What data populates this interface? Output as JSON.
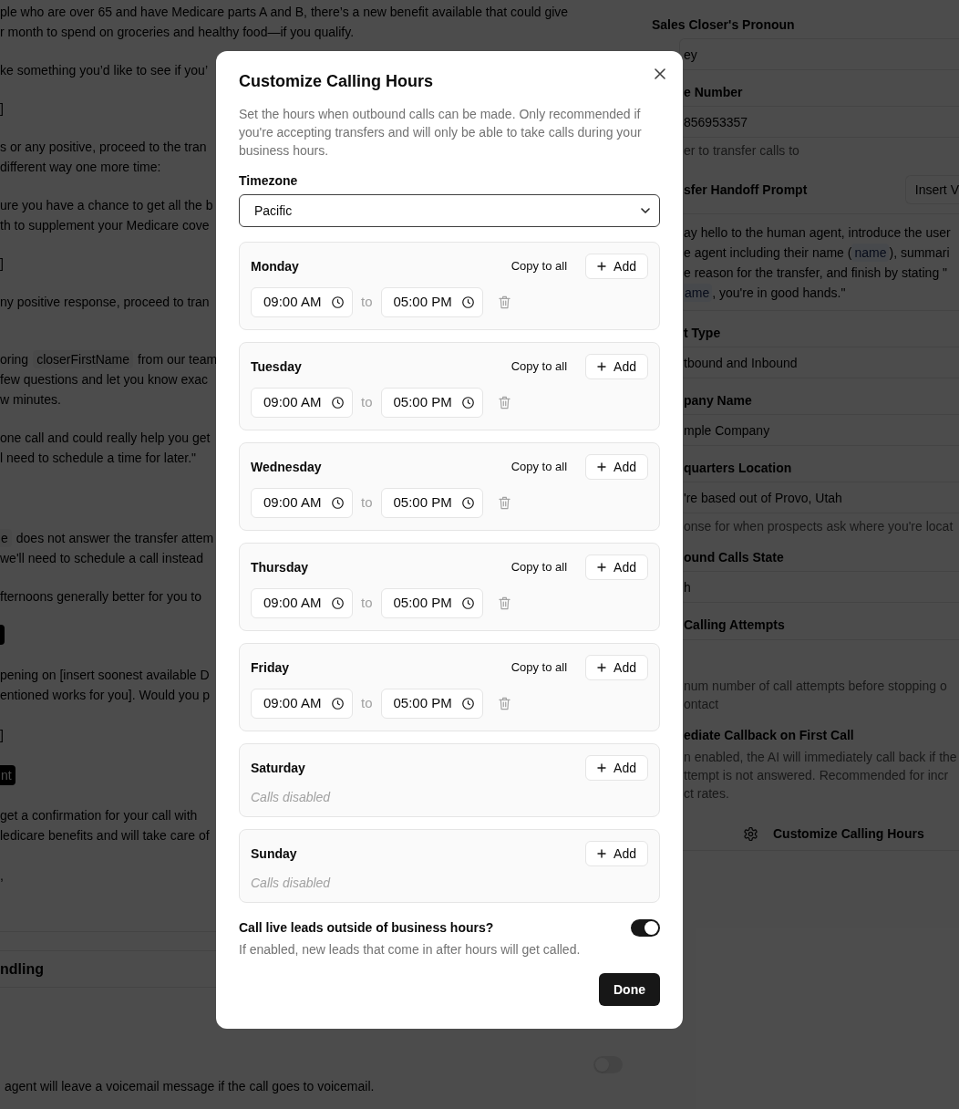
{
  "editor": {
    "paragraphs": [
      {
        "lines": [
          [
            {
              "kind": "text",
              "text": "ple who are over 65 and have Medicare parts A and B, there’s a new benefit available that could give"
            }
          ],
          [
            {
              "kind": "text",
              "text": "r month to spend on groceries and healthy food—if you qualify."
            }
          ]
        ]
      },
      {
        "lines": [
          [
            {
              "kind": "text",
              "text": "ke something you’d like to see if you’"
            }
          ]
        ]
      },
      {
        "lines": [
          [
            {
              "kind": "text",
              "text": "]"
            }
          ]
        ]
      },
      {
        "lines": [
          [
            {
              "kind": "text",
              "text": "s or any positive, proceed to the tran"
            }
          ],
          [
            {
              "kind": "text",
              "text": "different way one more time:"
            }
          ]
        ]
      },
      {
        "lines": [
          [
            {
              "kind": "text",
              "text": "ure you have a chance to get all the b"
            }
          ],
          [
            {
              "kind": "text",
              "text": "th to supplement your Medicare cove"
            }
          ]
        ]
      },
      {
        "lines": [
          [
            {
              "kind": "text",
              "text": "]"
            }
          ]
        ]
      },
      {
        "lines": [
          [
            {
              "kind": "text",
              "text": "ny positive response, proceed to tran"
            }
          ]
        ]
      },
      {
        "lines": [
          [
            {
              "kind": "text",
              "text": "oring"
            },
            {
              "kind": "chip",
              "text": "closerFirstName"
            },
            {
              "kind": "text",
              "text": "from our team"
            }
          ],
          [
            {
              "kind": "text",
              "text": "few questions and let you know exac"
            }
          ],
          [
            {
              "kind": "text",
              "text": "w minutes."
            }
          ]
        ]
      },
      {
        "lines": [
          [
            {
              "kind": "text",
              "text": "one call and could really help you get"
            }
          ],
          [
            {
              "kind": "text",
              "text": "l need to schedule a time for later.\""
            }
          ]
        ]
      },
      {
        "lines": [
          [
            {
              "kind": "chip",
              "text": "e"
            },
            {
              "kind": "text",
              "text": "does not answer the transfer attem"
            }
          ],
          [
            {
              "kind": "text",
              "text": "we'll need to schedule a call instead"
            }
          ]
        ]
      },
      {
        "lines": [
          [
            {
              "kind": "text",
              "text": "fternoons generally better for you to"
            }
          ]
        ]
      },
      {
        "lines": [
          [
            {
              "kind": "dark_chip"
            }
          ]
        ]
      },
      {
        "lines": [
          [
            {
              "kind": "text",
              "text": "pening on [insert soonest available D"
            }
          ],
          [
            {
              "kind": "text",
              "text": "entioned works for you]. Would you p"
            }
          ]
        ]
      },
      {
        "lines": [
          [
            {
              "kind": "text",
              "text": "]"
            }
          ]
        ]
      },
      {
        "lines": [
          [
            {
              "kind": "dark_chip",
              "text": "nt"
            }
          ]
        ]
      },
      {
        "lines": [
          [
            {
              "kind": "text",
              "text": "get a confirmation for your call with"
            }
          ],
          [
            {
              "kind": "text",
              "text": "ledicare benefits and will take care of"
            }
          ]
        ]
      },
      {
        "lines": [
          [
            {
              "kind": "text",
              "text": ","
            }
          ]
        ]
      }
    ]
  },
  "section": {
    "title": "ndling",
    "toggle": {
      "on": false
    },
    "description": "agent will leave a voicemail message if the call goes to voicemail."
  },
  "settings": {
    "fields": [
      {
        "kind": "input",
        "label": "Sales Closer's Pronoun",
        "value": "ey"
      },
      {
        "kind": "input",
        "label": "e Number",
        "value": "856953357",
        "help": [
          "er to transfer calls to"
        ]
      },
      {
        "kind": "prompt",
        "label": "sfer Handoff Prompt",
        "button": "Insert V",
        "lines": [
          [
            {
              "kind": "text",
              "text": "ay hello to the human agent, introduce the user"
            }
          ],
          [
            {
              "kind": "text",
              "text": "e agent including their name ("
            },
            {
              "kind": "chip",
              "text": "name"
            },
            {
              "kind": "text",
              "text": "), summari"
            }
          ],
          [
            {
              "kind": "text",
              "text": "e reason for the transfer, and finish by stating \""
            }
          ],
          [
            {
              "kind": "chip",
              "text": "ame"
            },
            {
              "kind": "text",
              "text": ", you're in good hands.\""
            }
          ]
        ]
      },
      {
        "kind": "input",
        "label": "t Type",
        "value": "tbound and Inbound"
      },
      {
        "kind": "input",
        "label": "pany Name",
        "value": "mple Company"
      },
      {
        "kind": "input",
        "label": "quarters Location",
        "value": "'re based out of Provo, Utah",
        "help": [
          "onse for when prospects ask where you're locat"
        ]
      },
      {
        "kind": "input",
        "label": "ound Calls State",
        "value": "h"
      },
      {
        "kind": "number",
        "label": "Calling Attempts",
        "help": [
          "num number of call attempts before stopping o",
          "ontact"
        ]
      },
      {
        "kind": "note",
        "label": "ediate Callback on First Call",
        "help": [
          "n enabled, the AI will immediately call back if the",
          "ttempt is not answered. Recommended for incr",
          "ct rates."
        ]
      }
    ],
    "button": "Customize Calling Hours"
  },
  "dialog": {
    "title": "Customize Calling Hours",
    "description": "Set the hours when outbound calls can be made. Only recommended if you're accepting transfers and will only be able to take calls during your business hours.",
    "timezone": {
      "label": "Timezone",
      "value": "Pacific"
    },
    "days": [
      {
        "name": "Monday",
        "copy_label": "Copy to all",
        "add_label": "Add",
        "slots": [
          {
            "start": "09:00 AM",
            "separator": "to",
            "end": "05:00 PM"
          }
        ]
      },
      {
        "name": "Tuesday",
        "copy_label": "Copy to all",
        "add_label": "Add",
        "slots": [
          {
            "start": "09:00 AM",
            "separator": "to",
            "end": "05:00 PM"
          }
        ]
      },
      {
        "name": "Wednesday",
        "copy_label": "Copy to all",
        "add_label": "Add",
        "slots": [
          {
            "start": "09:00 AM",
            "separator": "to",
            "end": "05:00 PM"
          }
        ]
      },
      {
        "name": "Thursday",
        "copy_label": "Copy to all",
        "add_label": "Add",
        "slots": [
          {
            "start": "09:00 AM",
            "separator": "to",
            "end": "05:00 PM"
          }
        ]
      },
      {
        "name": "Friday",
        "copy_label": "Copy to all",
        "add_label": "Add",
        "slots": [
          {
            "start": "09:00 AM",
            "separator": "to",
            "end": "05:00 PM"
          }
        ]
      },
      {
        "name": "Saturday",
        "add_label": "Add",
        "empty_text": "Calls disabled"
      },
      {
        "name": "Sunday",
        "add_label": "Add",
        "empty_text": "Calls disabled"
      }
    ],
    "after_hours": {
      "label": "Call live leads outside of business hours?",
      "on": true,
      "description": "If enabled, new leads that come in after hours will get called."
    },
    "done_label": "Done"
  }
}
